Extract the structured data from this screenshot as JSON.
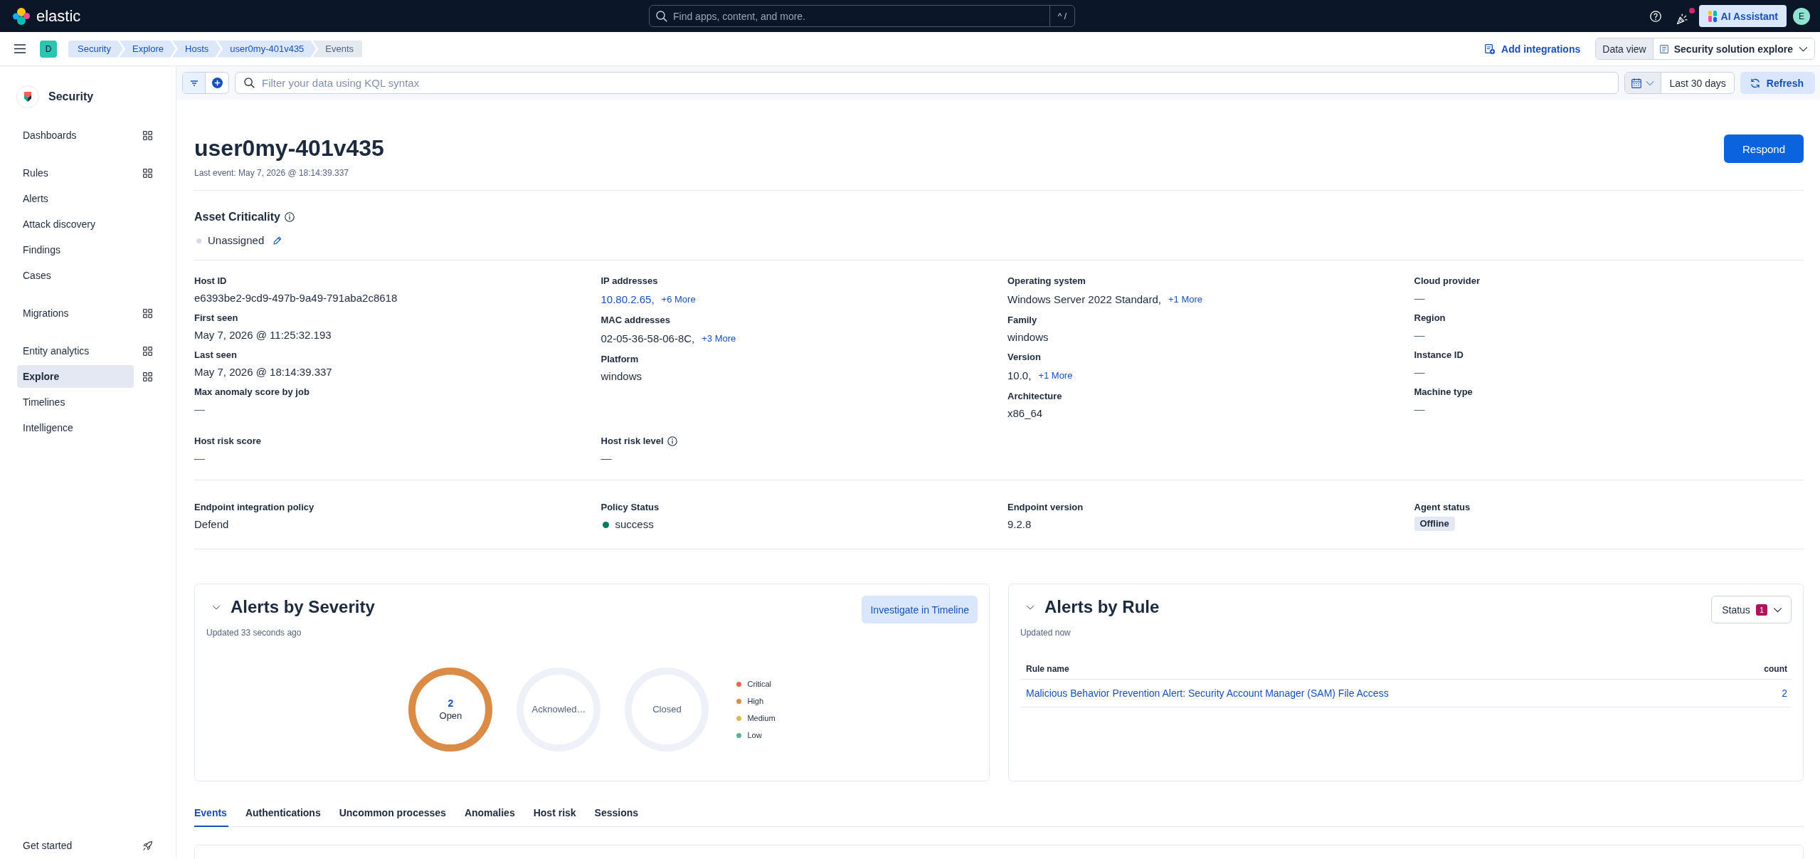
{
  "header": {
    "logo": "elastic",
    "search": {
      "placeholder": "Find apps, content, and more.",
      "shortcut": "^ /"
    },
    "news_unread": true,
    "assistant": "AI Assistant",
    "avatar": "E"
  },
  "breadcrumb_bar": {
    "space": "D",
    "breadcrumbs": [
      {
        "label": "Security",
        "current": false
      },
      {
        "label": "Explore",
        "current": false
      },
      {
        "label": "Hosts",
        "current": false
      },
      {
        "label": "user0my-401v435",
        "current": false
      },
      {
        "label": "Events",
        "current": true
      }
    ],
    "add_integrations": "Add integrations",
    "data_view": {
      "label": "Data view",
      "value": "Security solution explore"
    }
  },
  "sidebar": {
    "title": "Security",
    "groups": [
      {
        "items": [
          {
            "label": "Dashboards",
            "selected": false,
            "panel": true
          }
        ]
      },
      {
        "items": [
          {
            "label": "Rules",
            "selected": false,
            "panel": true
          },
          {
            "label": "Alerts",
            "selected": false,
            "panel": false
          },
          {
            "label": "Attack discovery",
            "selected": false,
            "panel": false
          },
          {
            "label": "Findings",
            "selected": false,
            "panel": false
          },
          {
            "label": "Cases",
            "selected": false,
            "panel": false
          }
        ]
      },
      {
        "items": [
          {
            "label": "Migrations",
            "selected": false,
            "panel": true
          }
        ]
      },
      {
        "items": [
          {
            "label": "Entity analytics",
            "selected": false,
            "panel": true
          },
          {
            "label": "Explore",
            "selected": true,
            "panel": true
          },
          {
            "label": "Timelines",
            "selected": false,
            "panel": false
          },
          {
            "label": "Intelligence",
            "selected": false,
            "panel": false
          }
        ]
      }
    ],
    "footer": "Get started"
  },
  "filter_bar": {
    "query": {
      "placeholder": "Filter your data using KQL syntax"
    },
    "date_range": "Last 30 days",
    "refresh": "Refresh"
  },
  "host": {
    "name": "user0my-401v435",
    "last_event": "Last event: May 7, 2026 @ 18:14:39.337",
    "respond": "Respond"
  },
  "asset_criticality": {
    "title": "Asset Criticality",
    "info": true,
    "value": "Unassigned"
  },
  "details": {
    "columns": [
      [
        {
          "label": "Host ID",
          "value": "e6393be2-9cd9-497b-9a49-791aba2c8618",
          "kind": "text"
        },
        {
          "label": "First seen",
          "value": "May 7, 2026 @ 11:25:32.193",
          "kind": "text"
        },
        {
          "label": "Last seen",
          "value": "May 7, 2026 @ 18:14:39.337",
          "kind": "text"
        },
        {
          "label": "Max anomaly score by job",
          "value": "—",
          "kind": "empty"
        }
      ],
      [
        {
          "label": "IP addresses",
          "value": "10.80.2.65,",
          "kind": "link",
          "more": "+6 More"
        },
        {
          "label": "MAC addresses",
          "value": "02-05-36-58-06-8C,",
          "kind": "text",
          "more": "+3 More"
        },
        {
          "label": "Platform",
          "value": "windows",
          "kind": "text"
        }
      ],
      [
        {
          "label": "Operating system",
          "value": "Windows Server 2022 Standard,",
          "kind": "text",
          "more": "+1 More"
        },
        {
          "label": "Family",
          "value": "windows",
          "kind": "text"
        },
        {
          "label": "Version",
          "value": "10.0,",
          "kind": "text",
          "more": "+1 More"
        },
        {
          "label": "Architecture",
          "value": "x86_64",
          "kind": "text"
        }
      ],
      [
        {
          "label": "Cloud provider",
          "value": "—",
          "kind": "empty"
        },
        {
          "label": "Region",
          "value": "—",
          "kind": "empty"
        },
        {
          "label": "Instance ID",
          "value": "—",
          "kind": "empty"
        },
        {
          "label": "Machine type",
          "value": "—",
          "kind": "empty"
        }
      ]
    ],
    "risk": [
      {
        "label": "Host risk score",
        "value": "—",
        "kind": "empty",
        "info": false
      },
      {
        "label": "Host risk level",
        "value": "—",
        "kind": "link",
        "info": true
      }
    ]
  },
  "endpoint": [
    {
      "label": "Endpoint integration policy",
      "value": "Defend",
      "kind": "text"
    },
    {
      "label": "Policy Status",
      "value": "success",
      "kind": "status"
    },
    {
      "label": "Endpoint version",
      "value": "9.2.8",
      "kind": "text"
    },
    {
      "label": "Agent status",
      "value": "Offline",
      "kind": "badge"
    }
  ],
  "alerts_by_severity": {
    "title": "Alerts by Severity",
    "expanded": true,
    "updated": "Updated 33 seconds ago",
    "action": "Investigate in Timeline",
    "donuts": [
      {
        "count": "2",
        "label": "Open",
        "color": "#da8b45"
      },
      {
        "label": "Acknowled…",
        "color": "#eef2f8"
      },
      {
        "label": "Closed",
        "color": "#eef2f8"
      }
    ],
    "legend": [
      {
        "label": "Critical",
        "color": "#e7664c"
      },
      {
        "label": "High",
        "color": "#da8b45"
      },
      {
        "label": "Medium",
        "color": "#d6bf57"
      },
      {
        "label": "Low",
        "color": "#54b399"
      }
    ]
  },
  "alerts_by_rule": {
    "title": "Alerts by Rule",
    "expanded": true,
    "updated": "Updated now",
    "status_filter": {
      "label": "Status",
      "count": "1"
    },
    "table": {
      "columns": [
        "Rule name",
        "count"
      ],
      "rows": [
        {
          "rule_name": "Malicious Behavior Prevention Alert: Security Account Manager (SAM) File Access",
          "count": "2"
        }
      ]
    }
  },
  "tabs": [
    {
      "label": "Events",
      "selected": true
    },
    {
      "label": "Authentications",
      "selected": false
    },
    {
      "label": "Uncommon processes",
      "selected": false
    },
    {
      "label": "Anomalies",
      "selected": false
    },
    {
      "label": "Host risk",
      "selected": false
    },
    {
      "label": "Sessions",
      "selected": false
    }
  ]
}
